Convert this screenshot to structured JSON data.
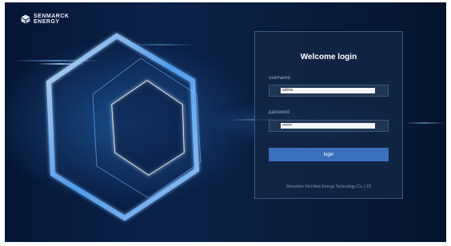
{
  "brand": {
    "name_line1": "SENMARCK",
    "name_line2": "ENERGY",
    "logo_icon": "cube-logo-icon"
  },
  "login": {
    "title": "Welcome login",
    "username_label": "username:",
    "username_value": "admin",
    "password_label": "password:",
    "password_value": "•••••••",
    "button_label": "login"
  },
  "footer": {
    "company": "Shenzhen Xinl New Energy Technology Co.,LTD"
  },
  "colors": {
    "background": "#0a1d3d",
    "panel": "#142646",
    "button": "#3a6fbc",
    "accent_glow": "#6fb6ff"
  }
}
